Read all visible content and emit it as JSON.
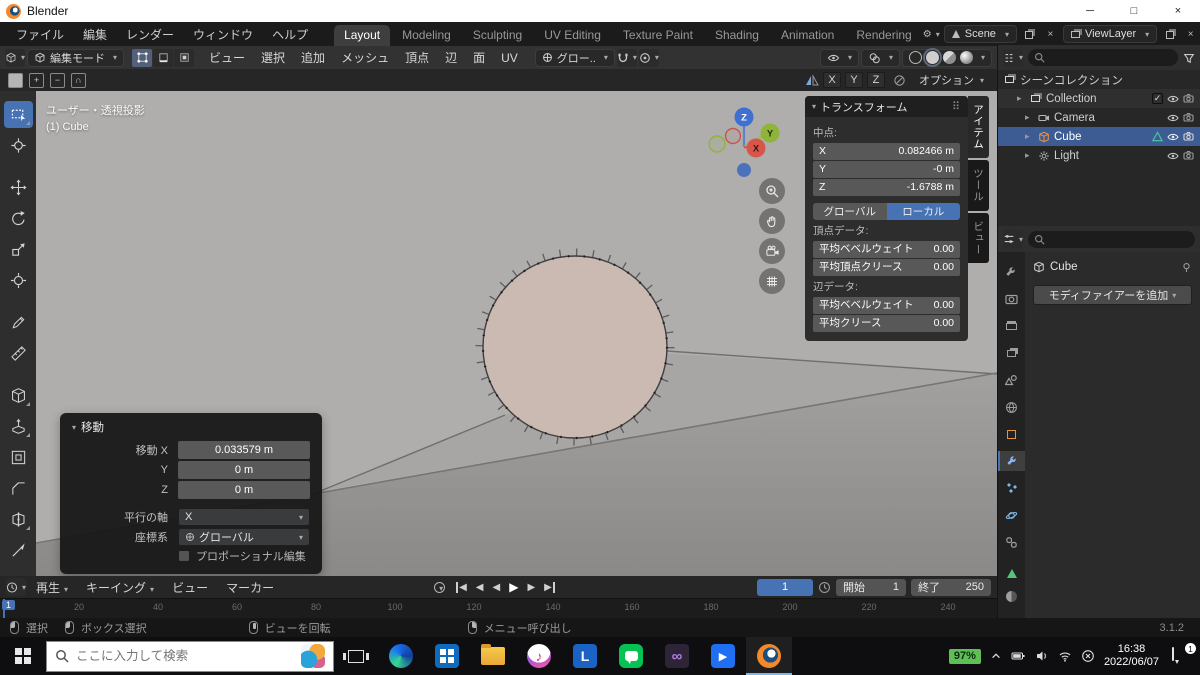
{
  "colors": {
    "accent_blue": "#4772b3",
    "blender_orange": "#f5882b",
    "battery_green": "#5fbf56",
    "viewport_gray": "#b0aeac",
    "circle_face": "#cbbab1"
  },
  "titlebar": {
    "app_title": "Blender"
  },
  "topbar": {
    "menus": [
      "ファイル",
      "編集",
      "レンダー",
      "ウィンドウ",
      "ヘルプ"
    ],
    "workspaces": [
      "Layout",
      "Modeling",
      "Sculpting",
      "UV Editing",
      "Texture Paint",
      "Shading",
      "Animation",
      "Rendering"
    ],
    "scene_label": "Scene",
    "viewlayer_label": "ViewLayer"
  },
  "viewport_header": {
    "mode": "編集モード",
    "menus": [
      "ビュー",
      "選択",
      "追加",
      "メッシュ",
      "頂点",
      "辺",
      "面",
      "UV"
    ],
    "orientation": "グロー..",
    "mirror_axes": [
      "X",
      "Y",
      "Z"
    ],
    "options": "オプション"
  },
  "viewport": {
    "view_label": "ユーザー・透視投影",
    "object_label": "(1) Cube",
    "gizmo": {
      "x": "X",
      "y": "Y",
      "z": "Z"
    },
    "tools": [
      "box-select",
      "cursor",
      "move",
      "rotate",
      "scale",
      "transform",
      "annotate",
      "measure",
      "add-cube",
      "extrude-region",
      "inset-faces",
      "bevel",
      "loop-cut",
      "knife"
    ]
  },
  "move_panel": {
    "title": "移動",
    "rows": [
      {
        "label": "移動 X",
        "value": "0.033579 m"
      },
      {
        "label": "Y",
        "value": "0 m"
      },
      {
        "label": "Z",
        "value": "0 m"
      }
    ],
    "orient_label": "平行の軸",
    "orient_value": "X",
    "coord_label": "座標系",
    "coord_value": "グローバル",
    "proportional": "プロポーショナル編集"
  },
  "sidebar": {
    "tabs": [
      "アイテム",
      "ツール",
      "ビュー"
    ],
    "transform": {
      "title": "トランスフォーム",
      "median_label": "中点:",
      "median": [
        {
          "axis": "X",
          "value": "0.082466 m"
        },
        {
          "axis": "Y",
          "value": "-0 m"
        },
        {
          "axis": "Z",
          "value": "-1.6788 m"
        }
      ],
      "space_global": "グローバル",
      "space_local": "ローカル",
      "vertex_label": "頂点データ:",
      "vertex_rows": [
        {
          "label": "平均ベベルウェイト",
          "value": "0.00"
        },
        {
          "label": "平均頂点クリース",
          "value": "0.00"
        }
      ],
      "edge_label": "辺データ:",
      "edge_rows": [
        {
          "label": "平均ベベルウェイト",
          "value": "0.00"
        },
        {
          "label": "平均クリース",
          "value": "0.00"
        }
      ]
    }
  },
  "outliner": {
    "scene_collection": "シーンコレクション",
    "collection": "Collection",
    "objects": [
      "Camera",
      "Cube",
      "Light"
    ]
  },
  "properties": {
    "object_name": "Cube",
    "add_modifier": "モディファイアーを追加"
  },
  "timeline": {
    "menus": [
      "再生",
      "キーイング",
      "ビュー",
      "マーカー"
    ],
    "current_frame": "1",
    "start_label": "開始",
    "start_value": "1",
    "end_label": "終了",
    "end_value": "250",
    "ticks": [
      "20",
      "40",
      "60",
      "80",
      "100",
      "120",
      "140",
      "160",
      "180",
      "200",
      "220",
      "240"
    ]
  },
  "statusbar": {
    "hints": [
      "選択",
      "ボックス選択",
      "ビューを回転",
      "メニュー呼び出し"
    ],
    "version": "3.1.2"
  },
  "taskbar": {
    "search_placeholder": "ここに入力して検索",
    "battery": "97%",
    "time": "16:38",
    "date": "2022/06/07",
    "notifications": "1"
  }
}
